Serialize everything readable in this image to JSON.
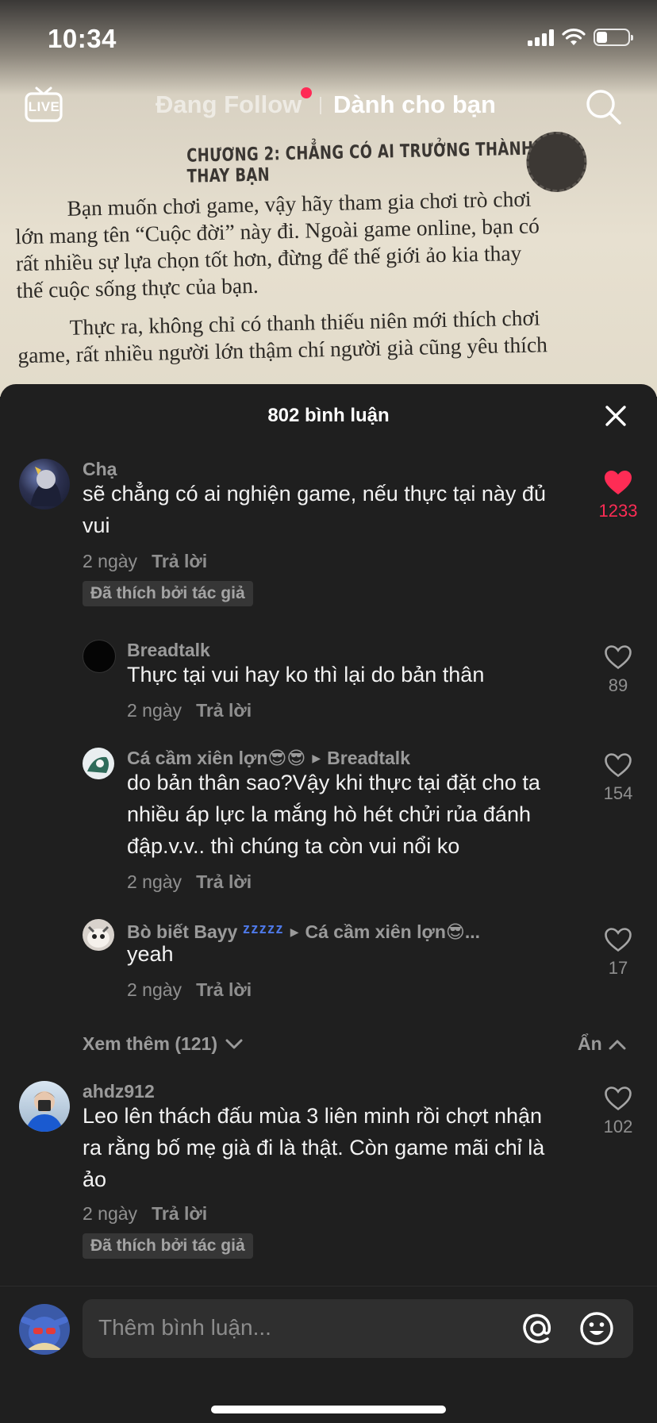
{
  "status_bar": {
    "time": "10:34",
    "battery_level": 0.35
  },
  "video": {
    "book_chapter": "CHƯƠNG 2: CHẲNG CÓ AI TRƯỞNG THÀNH THAY BẠN",
    "book_lines": [
      "Bạn muốn chơi game, vậy hãy tham gia chơi trò chơi",
      "lớn mang tên “Cuộc đời” này đi. Ngoài game online, bạn có",
      "rất nhiều sự lựa chọn tốt hơn, đừng để thế giới ảo kia thay",
      "thế cuộc sống thực của bạn.",
      "Thực ra, không chỉ có thanh thiếu niên mới thích chơi",
      "game, rất nhiều người lớn thậm chí người già cũng yêu thích"
    ]
  },
  "top_nav": {
    "live_label": "LIVE",
    "following": "Đang Follow",
    "for_you": "Dành cho bạn"
  },
  "comments_sheet": {
    "title": "802 bình luận",
    "comments": [
      {
        "user": "Chạ",
        "text": "sẽ chẳng có ai nghiện game, nếu thực tại này đủ vui",
        "time": "2 ngày",
        "reply": "Trả lời",
        "badge": "Đã thích bởi tác giả",
        "likes": "1233",
        "liked": true
      },
      {
        "user": "Breadtalk",
        "text": "Thực tại vui hay ko thì lại do bản thân",
        "time": "2 ngày",
        "reply": "Trả lời",
        "likes": "89"
      },
      {
        "user": "Cá cầm xiên lợn😎😎",
        "reply_to": "Breadtalk",
        "text": "do bản thân sao?Vậy khi thực tại đặt cho ta nhiều áp lực la mắng hò hét chửi rủa đánh đập.v.v.. thì chúng ta còn vui nổi ko",
        "time": "2 ngày",
        "reply": "Trả lời",
        "likes": "154"
      },
      {
        "user": "Bò biết Bayy",
        "user_decoration": "ᶻᶻᶻᶻᶻ",
        "reply_to": "Cá cầm xiên lợn😎...",
        "text": "yeah",
        "time": "2 ngày",
        "reply": "Trả lời",
        "likes": "17"
      },
      {
        "user": "ahdz912",
        "text": "Leo lên thách đấu mùa 3 liên minh rồi chợt nhận ra rằng bố mẹ già đi là thật. Còn game mãi chỉ là ảo",
        "time": "2 ngày",
        "reply": "Trả lời",
        "badge": "Đã thích bởi tác giả",
        "likes": "102"
      }
    ],
    "view_more": "Xem thêm (121)",
    "hide": "Ẩn"
  },
  "input_bar": {
    "placeholder": "Thêm bình luận..."
  },
  "colors": {
    "accent_red": "#fe2c55",
    "sheet_bg": "#1f1f1f",
    "input_bg": "#2f2f2f"
  }
}
